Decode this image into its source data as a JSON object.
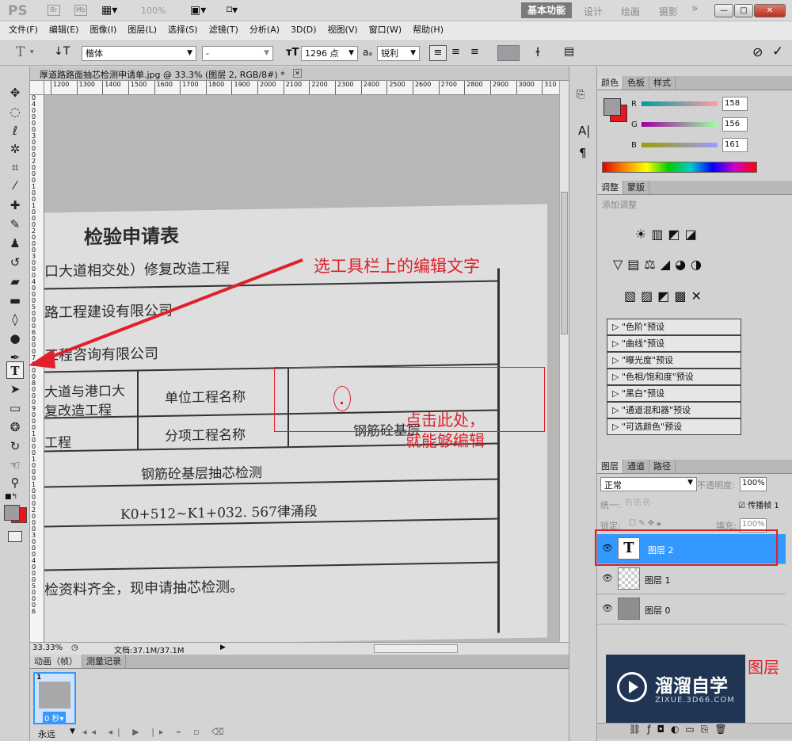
{
  "app": {
    "logo": "PS",
    "titlebar_buttons": [
      "Br",
      "Mb"
    ],
    "zoom_level": "100%",
    "workspaces": {
      "active": "基本功能",
      "others": [
        "设计",
        "绘画",
        "摄影"
      ],
      "more": "»"
    },
    "window_controls": [
      "—",
      "□",
      "✕"
    ]
  },
  "menu": [
    "文件(F)",
    "编辑(E)",
    "图像(I)",
    "图层(L)",
    "选择(S)",
    "滤镜(T)",
    "分析(A)",
    "3D(D)",
    "视图(V)",
    "窗口(W)",
    "帮助(H)"
  ],
  "options": {
    "tool_glyph": "T",
    "font_family": "楷体",
    "font_style": "-",
    "font_size": "1296 点",
    "aa_label": "aₐ",
    "antialias": "锐利"
  },
  "document": {
    "tab_title": "厚道路路面抽芯检测申请单.jpg @ 33.3% (图层 2, RGB/8#) *",
    "ruler_h": [
      "1200",
      "1300",
      "1400",
      "1500",
      "1600",
      "1700",
      "1800",
      "1900",
      "2000",
      "2100",
      "2200",
      "2300",
      "2400",
      "2500",
      "2600",
      "2700",
      "2800",
      "2900",
      "3000",
      "310"
    ],
    "ruler_v": [
      "0",
      "4",
      "0",
      "0",
      "0",
      "0",
      "3",
      "0",
      "0",
      "0",
      "2",
      "0",
      "0",
      "0",
      "1",
      "0",
      "0",
      "1",
      "0",
      "0",
      "0",
      "2",
      "0",
      "0",
      "0",
      "3",
      "0",
      "0",
      "0",
      "4",
      "0",
      "0",
      "0",
      "5",
      "0",
      "0",
      "0",
      "6",
      "0",
      "0",
      "0",
      "7",
      "0",
      "0",
      "0",
      "8",
      "0",
      "0",
      "0",
      "9",
      "0",
      "0",
      "0",
      "1",
      "0",
      "0",
      "0",
      "1",
      "0",
      "0",
      "0",
      "1",
      "0",
      "0",
      "0",
      "2",
      "0",
      "0",
      "0",
      "3",
      "0",
      "0",
      "0",
      "4",
      "0",
      "0",
      "0",
      "5",
      "0",
      "0",
      "0",
      "6"
    ],
    "paper": {
      "heading": "检验申请表",
      "line1": "口大道相交处）修复改造工程",
      "line2": "路工程建设有限公司",
      "line3": "工程咨询有限公司",
      "cell_a1": "大道与港口大",
      "cell_a2": "复改造工程",
      "label_unit": "单位工程名称",
      "cell_b": "工程",
      "label_sub": "分项工程名称",
      "value_sub": "钢筋砼基层",
      "row_test": "钢筋砼基层抽芯检测",
      "row_range": "K0+512~K1+032. 567律涌段",
      "footer": "检资料齐全，现申请抽芯检测。"
    }
  },
  "annotations": {
    "toolbar_hint": "选工具栏上的编辑文字",
    "click_hint_1": "点击此处，",
    "click_hint_2": "就能够编辑",
    "layer_hint": "图层"
  },
  "status": {
    "zoom": "33.33%",
    "doc_size": "文档:37.1M/37.1M"
  },
  "animation": {
    "tabs": [
      "动画（帧）",
      "测量记录"
    ],
    "frame_number": "1",
    "frame_delay": "0 秒▾",
    "loop": "永远"
  },
  "color_panel": {
    "tabs": [
      "颜色",
      "色板",
      "样式"
    ],
    "channels": [
      {
        "name": "R",
        "value": "158"
      },
      {
        "name": "G",
        "value": "156"
      },
      {
        "name": "B",
        "value": "161"
      }
    ]
  },
  "adjust_panel": {
    "tabs": [
      "调整",
      "蒙版"
    ],
    "title": "添加调整",
    "presets": [
      "\"色阶\"预设",
      "\"曲线\"预设",
      "\"曝光度\"预设",
      "\"色相/饱和度\"预设",
      "\"黑白\"预设",
      "\"通道混和器\"预设",
      "\"可选颜色\"预设"
    ]
  },
  "layers_panel": {
    "tabs": [
      "图层",
      "通道",
      "路径"
    ],
    "blend_mode": "正常",
    "opacity_label": "不透明度:",
    "opacity": "100%",
    "unify_label": "统一:",
    "propagate_label": "传播帧 1",
    "lock_label": "锁定:",
    "fill_label": "填充:",
    "fill": "100%",
    "layers": [
      {
        "name": "图层 2",
        "type": "text",
        "selected": true
      },
      {
        "name": "图层 1",
        "type": "empty",
        "selected": false
      },
      {
        "name": "图层 0",
        "type": "image",
        "selected": false
      }
    ]
  },
  "watermark": {
    "brand": "溜溜自学",
    "url": "ZIXUE.3D66.COM"
  },
  "colors": {
    "accent_red": "#e0202a",
    "selection_blue": "#3399ff",
    "fg_swatch": "#9e9ca1",
    "bg_swatch": "#e8141e",
    "watermark_bg": "#1f3553"
  }
}
